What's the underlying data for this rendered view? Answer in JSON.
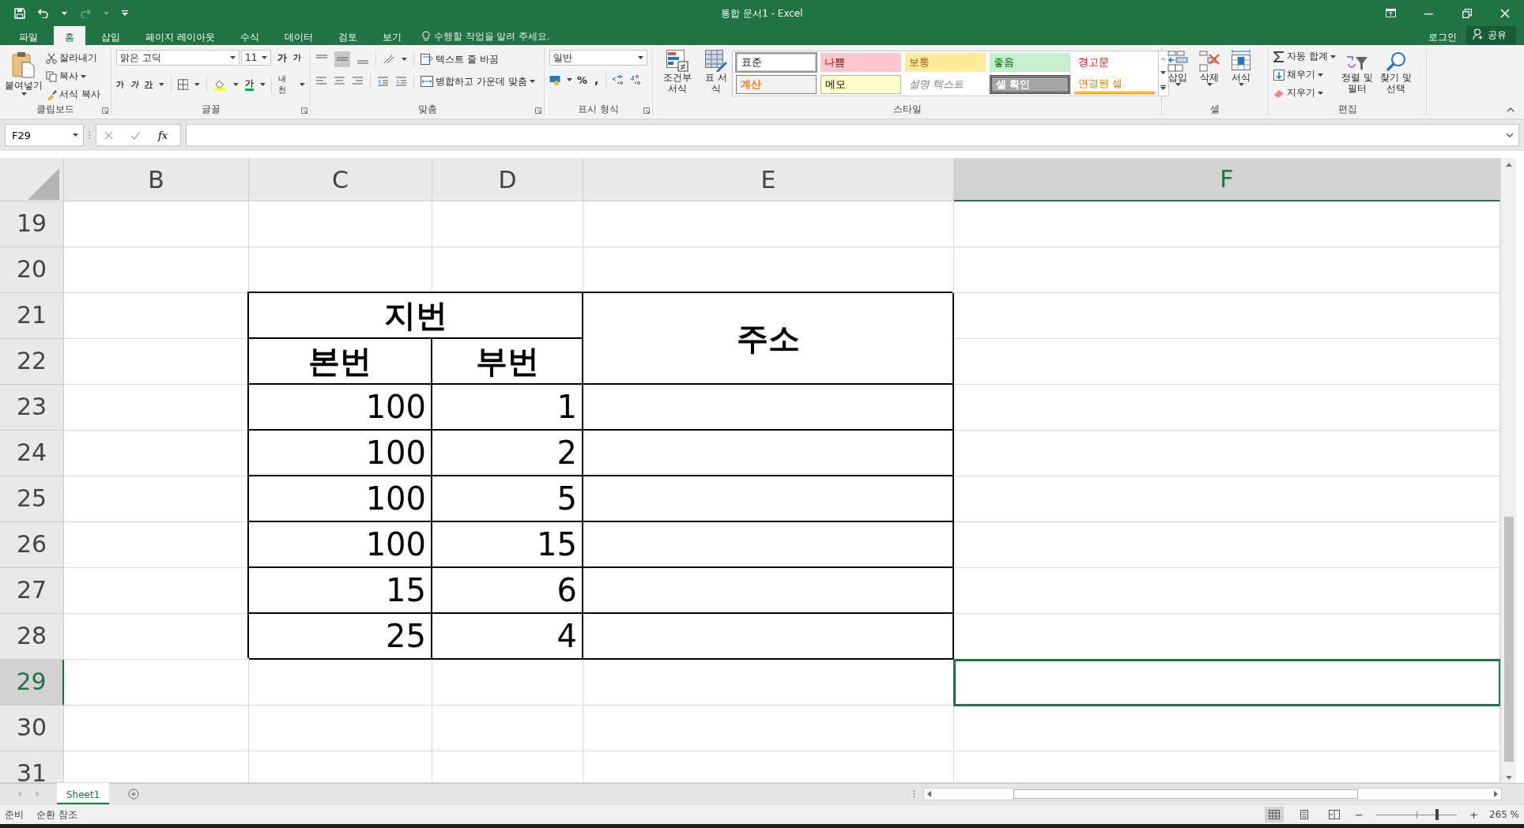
{
  "window": {
    "title": "통합 문서1 - Excel"
  },
  "ribbon_tabs": [
    {
      "label": "파일",
      "selected": false
    },
    {
      "label": "홈",
      "selected": true
    },
    {
      "label": "삽입",
      "selected": false
    },
    {
      "label": "페이지 레이아웃",
      "selected": false
    },
    {
      "label": "수식",
      "selected": false
    },
    {
      "label": "데이터",
      "selected": false
    },
    {
      "label": "검토",
      "selected": false
    },
    {
      "label": "보기",
      "selected": false
    }
  ],
  "tell_me": {
    "placeholder": "수행할 작업을 알려 주세요."
  },
  "account": {
    "sign_in": "로그인",
    "share": "공유"
  },
  "clipboard": {
    "paste": "붙여넣기",
    "cut": "잘라내기",
    "copy": "복사",
    "format_painter": "서식 복사",
    "label": "클립보드"
  },
  "font": {
    "name": "맑은 고딕",
    "size": "11",
    "grow": "가",
    "shrink": "가",
    "bold": "가",
    "italic": "가",
    "underline": "가",
    "font_color": "가",
    "phonetic": "내천",
    "label": "글꼴"
  },
  "alignment": {
    "wrap_text": "텍스트 줄 바꿈",
    "merge_center": "병합하고 가운데 맞춤",
    "label": "맞춤"
  },
  "number": {
    "format": "일반",
    "percent": "%",
    "comma": ",",
    "label": "표시 형식"
  },
  "styles": {
    "conditional": "조건부 서식",
    "format_table": "표 서식",
    "label": "스타일",
    "cell_styles": [
      {
        "label": "표준",
        "kind": "normal",
        "selected": true
      },
      {
        "label": "나쁨",
        "kind": "bad",
        "selected": false
      },
      {
        "label": "보통",
        "kind": "neutral",
        "selected": false
      },
      {
        "label": "좋음",
        "kind": "good",
        "selected": false
      },
      {
        "label": "경고문",
        "kind": "warning",
        "selected": false
      },
      {
        "label": "계산",
        "kind": "calculation",
        "selected": false
      },
      {
        "label": "메모",
        "kind": "note",
        "selected": false
      },
      {
        "label": "설명 텍스트",
        "kind": "explanatory",
        "selected": false
      },
      {
        "label": "셀 확인",
        "kind": "check",
        "selected": false
      },
      {
        "label": "연결된 셀",
        "kind": "linked",
        "selected": false
      }
    ]
  },
  "cells": {
    "insert": "삽입",
    "delete": "삭제",
    "format": "서식",
    "label": "셀"
  },
  "editing": {
    "autosum": "자동 합계",
    "fill": "채우기",
    "clear": "지우기",
    "sort_filter": "정렬 및 필터",
    "find_select": "찾기 및 선택",
    "label": "편집"
  },
  "formula_bar": {
    "name_box": "F29",
    "function_label": "fx"
  },
  "sheet": {
    "columns": [
      {
        "label": "B",
        "selected": false
      },
      {
        "label": "C",
        "selected": false
      },
      {
        "label": "D",
        "selected": false
      },
      {
        "label": "E",
        "selected": false
      },
      {
        "label": "F",
        "selected": true
      }
    ],
    "rows": [
      {
        "label": "19",
        "selected": false,
        "cells": [
          {
            "kind": "plain",
            "selected": false
          },
          {
            "kind": "plain",
            "selected": false
          },
          {
            "kind": "plain",
            "selected": false
          },
          {
            "kind": "plain",
            "selected": false
          },
          {
            "kind": "plain",
            "selected": false
          }
        ]
      },
      {
        "label": "20",
        "selected": false,
        "cells": [
          {
            "kind": "plain",
            "selected": false
          },
          {
            "kind": "plain",
            "selected": false
          },
          {
            "kind": "plain",
            "selected": false
          },
          {
            "kind": "plain",
            "selected": false
          },
          {
            "kind": "plain",
            "selected": false
          }
        ]
      },
      {
        "label": "21",
        "selected": false,
        "cells": [
          {
            "kind": "plain",
            "selected": false
          },
          {
            "kind": "head_wide",
            "text": "지번",
            "selected": false
          },
          {
            "kind": "covered",
            "text": ""
          },
          {
            "kind": "head_tall",
            "text": "주소",
            "selected": false
          },
          {
            "kind": "plain",
            "selected": false
          }
        ]
      },
      {
        "label": "22",
        "selected": false,
        "cells": [
          {
            "kind": "plain",
            "selected": false
          },
          {
            "kind": "head",
            "text": "본번",
            "selected": false
          },
          {
            "kind": "head",
            "text": "부번",
            "selected": false
          },
          {
            "kind": "covered",
            "text": ""
          },
          {
            "kind": "plain",
            "selected": false
          }
        ]
      },
      {
        "label": "23",
        "selected": false,
        "cells": [
          {
            "kind": "plain",
            "selected": false
          },
          {
            "kind": "number",
            "text": "100",
            "selected": false
          },
          {
            "kind": "number",
            "text": "1",
            "selected": false
          },
          {
            "kind": "table",
            "selected": false
          },
          {
            "kind": "plain",
            "selected": false
          }
        ]
      },
      {
        "label": "24",
        "selected": false,
        "cells": [
          {
            "kind": "plain",
            "selected": false
          },
          {
            "kind": "number",
            "text": "100",
            "selected": false
          },
          {
            "kind": "number",
            "text": "2",
            "selected": false
          },
          {
            "kind": "table",
            "selected": false
          },
          {
            "kind": "plain",
            "selected": false
          }
        ]
      },
      {
        "label": "25",
        "selected": false,
        "cells": [
          {
            "kind": "plain",
            "selected": false
          },
          {
            "kind": "number",
            "text": "100",
            "selected": false
          },
          {
            "kind": "number",
            "text": "5",
            "selected": false
          },
          {
            "kind": "table",
            "selected": false
          },
          {
            "kind": "plain",
            "selected": false
          }
        ]
      },
      {
        "label": "26",
        "selected": false,
        "cells": [
          {
            "kind": "plain",
            "selected": false
          },
          {
            "kind": "number",
            "text": "100",
            "selected": false
          },
          {
            "kind": "number",
            "text": "15",
            "selected": false
          },
          {
            "kind": "table",
            "selected": false
          },
          {
            "kind": "plain",
            "selected": false
          }
        ]
      },
      {
        "label": "27",
        "selected": false,
        "cells": [
          {
            "kind": "plain",
            "selected": false
          },
          {
            "kind": "number",
            "text": "15",
            "selected": false
          },
          {
            "kind": "number",
            "text": "6",
            "selected": false
          },
          {
            "kind": "table",
            "selected": false
          },
          {
            "kind": "plain",
            "selected": false
          }
        ]
      },
      {
        "label": "28",
        "selected": false,
        "cells": [
          {
            "kind": "plain",
            "selected": false
          },
          {
            "kind": "number",
            "text": "25",
            "selected": false
          },
          {
            "kind": "number",
            "text": "4",
            "selected": false
          },
          {
            "kind": "table",
            "selected": false
          },
          {
            "kind": "plain",
            "selected": false
          }
        ]
      },
      {
        "label": "29",
        "selected": true,
        "cells": [
          {
            "kind": "plain",
            "selected": false
          },
          {
            "kind": "plain",
            "selected": false
          },
          {
            "kind": "plain",
            "selected": false
          },
          {
            "kind": "plain",
            "selected": false
          },
          {
            "kind": "plain",
            "selected": true
          }
        ]
      },
      {
        "label": "30",
        "selected": false,
        "cells": [
          {
            "kind": "plain",
            "selected": false
          },
          {
            "kind": "plain",
            "selected": false
          },
          {
            "kind": "plain",
            "selected": false
          },
          {
            "kind": "plain",
            "selected": false
          },
          {
            "kind": "plain",
            "selected": false
          }
        ]
      },
      {
        "label": "31",
        "selected": false,
        "cells": [
          {
            "kind": "plain",
            "selected": false
          },
          {
            "kind": "plain",
            "selected": false
          },
          {
            "kind": "plain",
            "selected": false
          },
          {
            "kind": "plain",
            "selected": false
          },
          {
            "kind": "plain",
            "selected": false
          }
        ]
      }
    ]
  },
  "sheet_tabs": [
    {
      "label": "Sheet1",
      "selected": true
    }
  ],
  "status_bar": {
    "mode": "준비",
    "circular": "순환 참조",
    "views": [
      {
        "kind": "normal",
        "selected": true
      },
      {
        "kind": "page_layout",
        "selected": false
      },
      {
        "kind": "page_break",
        "selected": false
      }
    ],
    "zoom_out": "−",
    "zoom_in": "+",
    "zoom_slider": {
      "level": 0.76
    },
    "zoom": "265 %"
  }
}
